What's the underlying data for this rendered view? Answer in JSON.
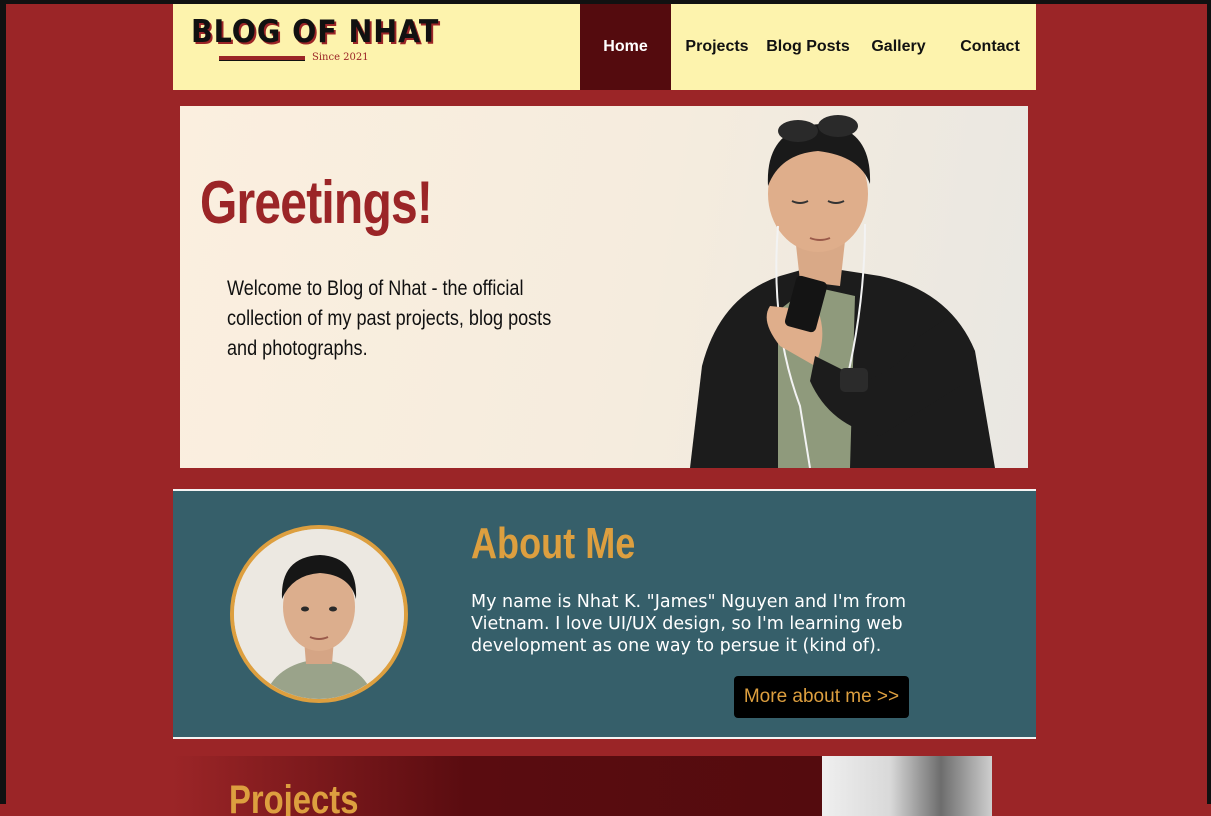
{
  "header": {
    "logo_title": "BLOG OF NHAT",
    "logo_since": "Since 2021",
    "nav": [
      {
        "label": "Home",
        "active": true
      },
      {
        "label": "Projects",
        "active": false
      },
      {
        "label": "Blog Posts",
        "active": false
      },
      {
        "label": "Gallery",
        "active": false
      },
      {
        "label": "Contact",
        "active": false
      }
    ]
  },
  "hero": {
    "title": "Greetings!",
    "text": "Welcome to Blog of Nhat - the official collection of my past projects, blog posts and photographs."
  },
  "about": {
    "title": "About Me",
    "text": "My name is Nhat K. \"James\" Nguyen and I'm from Vietnam. I love UI/UX design, so I'm learning web development as one way to persue it (kind of).",
    "button": "More about me >>"
  },
  "projects": {
    "title": "Projects"
  },
  "colors": {
    "background": "#9b2527",
    "header_bg": "#fdf3ad",
    "nav_active": "#540b0e",
    "about_bg": "#365f6a",
    "accent": "#dd9f3f"
  }
}
